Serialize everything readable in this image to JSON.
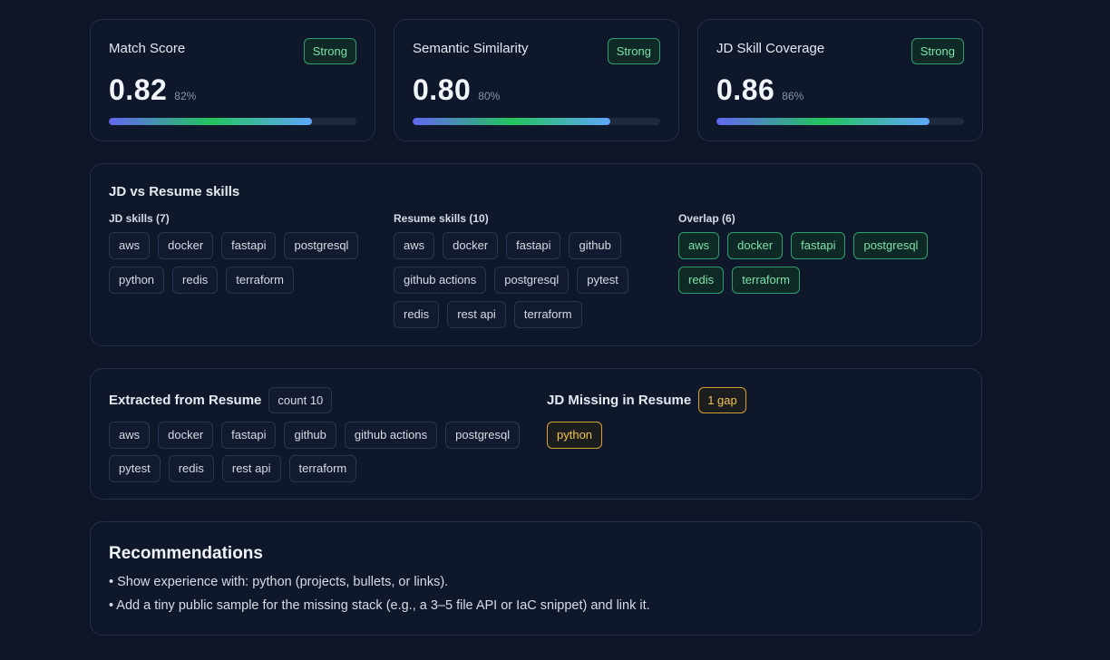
{
  "metrics": [
    {
      "title": "Match Score",
      "badge": "Strong",
      "value": "0.82",
      "pct": "82%",
      "fill": 0.82
    },
    {
      "title": "Semantic Similarity",
      "badge": "Strong",
      "value": "0.80",
      "pct": "80%",
      "fill": 0.8
    },
    {
      "title": "JD Skill Coverage",
      "badge": "Strong",
      "value": "0.86",
      "pct": "86%",
      "fill": 0.86
    }
  ],
  "skills": {
    "title": "JD vs Resume skills",
    "jd": {
      "title": "JD skills (7)",
      "items": [
        "aws",
        "docker",
        "fastapi",
        "postgresql",
        "python",
        "redis",
        "terraform"
      ]
    },
    "resume": {
      "title": "Resume skills (10)",
      "items": [
        "aws",
        "docker",
        "fastapi",
        "github",
        "github actions",
        "postgresql",
        "pytest",
        "redis",
        "rest api",
        "terraform"
      ]
    },
    "overlap": {
      "title": "Overlap (6)",
      "items": [
        "aws",
        "docker",
        "fastapi",
        "postgresql",
        "redis",
        "terraform"
      ]
    }
  },
  "extracted": {
    "title": "Extracted from Resume",
    "count_badge": "count 10",
    "items": [
      "aws",
      "docker",
      "fastapi",
      "github",
      "github actions",
      "postgresql",
      "pytest",
      "redis",
      "rest api",
      "terraform"
    ]
  },
  "missing": {
    "title": "JD Missing in Resume",
    "gap_badge": "1 gap",
    "items": [
      "python"
    ]
  },
  "recommendations": {
    "title": "Recommendations",
    "lines": [
      "• Show experience with: python (projects, bullets, or links).",
      "• Add a tiny public sample for the missing stack (e.g., a 3–5 file API or IaC snippet) and link it."
    ]
  }
}
